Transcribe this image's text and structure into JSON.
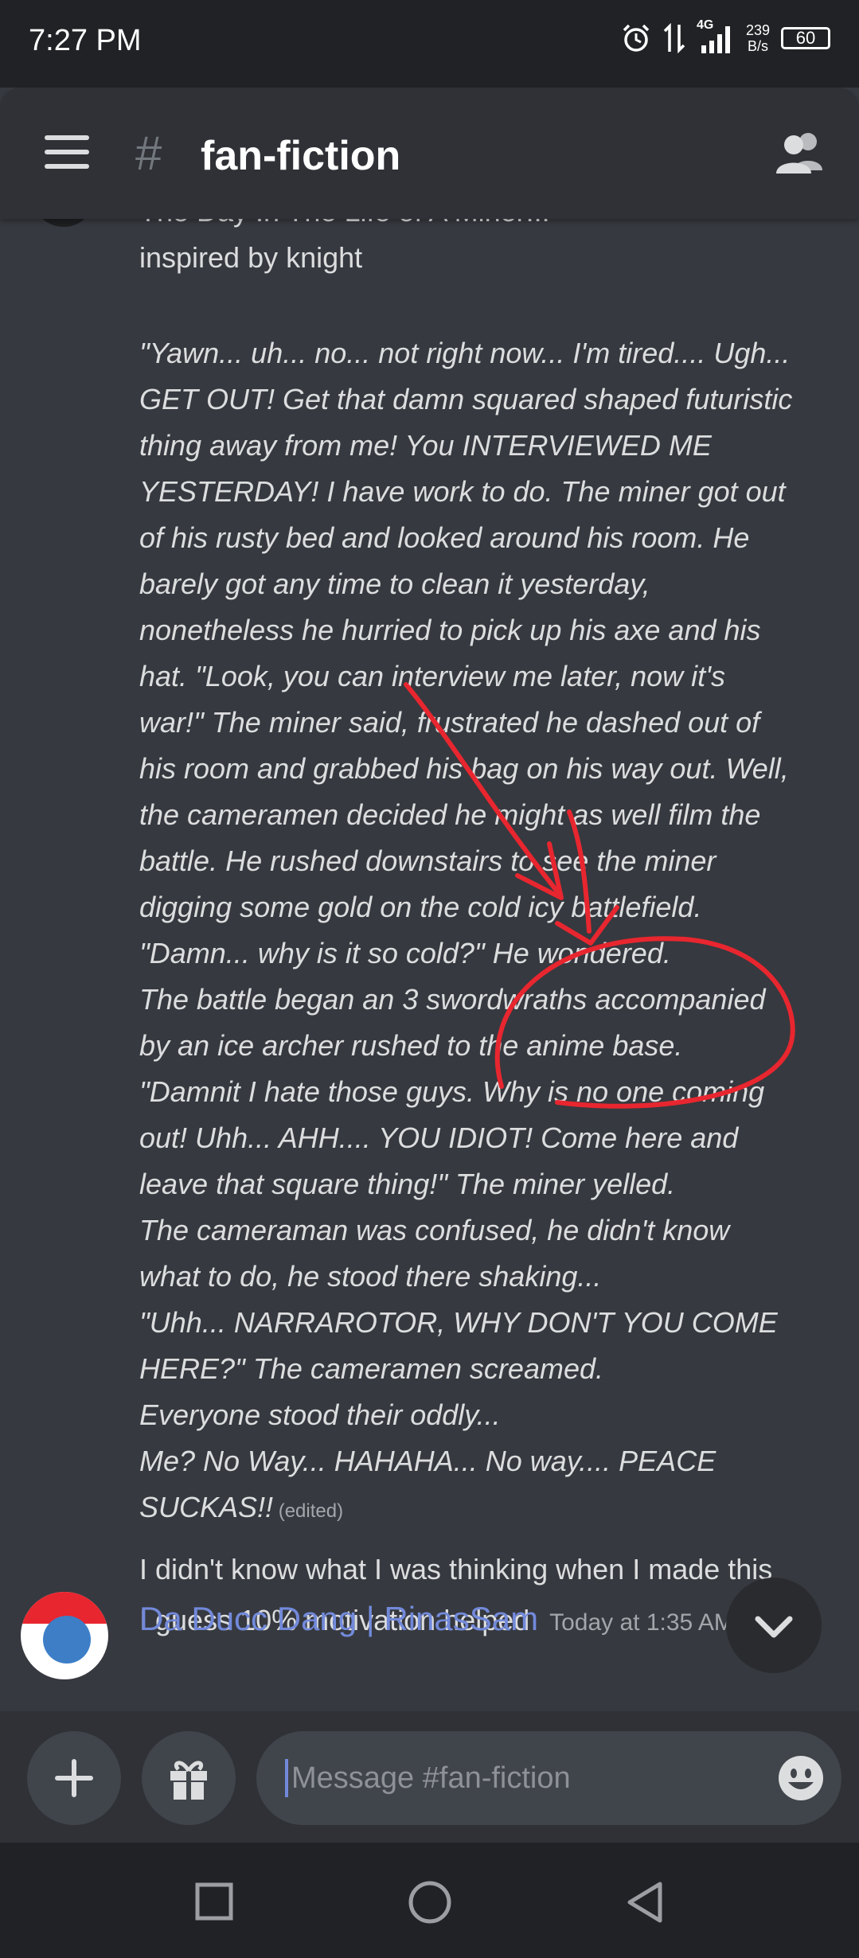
{
  "status_bar": {
    "time": "7:27 PM",
    "network": "4G",
    "net_speed": "239",
    "net_speed_unit": "B/s",
    "battery": "60"
  },
  "header": {
    "hash_symbol": "#",
    "channel_name": "fan-fiction"
  },
  "messages": {
    "title_partial": "The Day In The Life of A Miner!!!",
    "inspired": "inspired by knight",
    "story_lines": [
      "\"Yawn... uh... no... not right now... I'm tired.... Ugh...",
      "GET OUT! Get that damn squared shaped futuristic",
      "thing away from me! You INTERVIEWED ME",
      "YESTERDAY! I have work to do. The miner got out",
      "of his rusty bed and looked around his room. He",
      "barely got any time to clean it yesterday,",
      "nonetheless he hurried to pick up his axe and his",
      "hat. \"Look, you can interview me later, now it's",
      "war!\" The miner said, frustrated he dashed out of",
      "his room and grabbed his bag on his way out. Well,",
      "the cameramen decided he might as well film the",
      "battle. He rushed downstairs to see the miner",
      "digging some gold on the cold icy battlefield.",
      "\"Damn... why is it so cold?\" He wondered.",
      "The battle began an 3 swordwraths accompanied",
      "by an ice archer rushed to the anime base.",
      "\"Damnit I hate those guys. Why is no one coming",
      "out! Uhh... AHH.... YOU IDIOT! Come here and",
      "leave that square thing!\" The miner yelled.",
      "The cameraman was confused, he didn't know",
      "what to do, he stood there shaking...",
      "\"Uhh... NARRAROTOR, WHY DON'T YOU COME",
      "HERE?\" The cameramen screamed.",
      "Everyone stood their oddly...",
      "Me? No Way... HAHAHA... No way.... PEACE",
      "SUCKAS!!"
    ],
    "edited_tag": "(edited)",
    "followup_1": "I didn't know what I was thinking when I made this",
    "followup_2": "I guess 10% motivation helped",
    "next_author": "Da Ducc Dang | RinasSam",
    "next_time": "Today at 1:35 AM"
  },
  "composer": {
    "placeholder": "Message #fan-fiction"
  },
  "colors": {
    "background": "#36393f",
    "header": "#2f3136",
    "accent": "#7289da",
    "annotation": "#e8262f"
  }
}
